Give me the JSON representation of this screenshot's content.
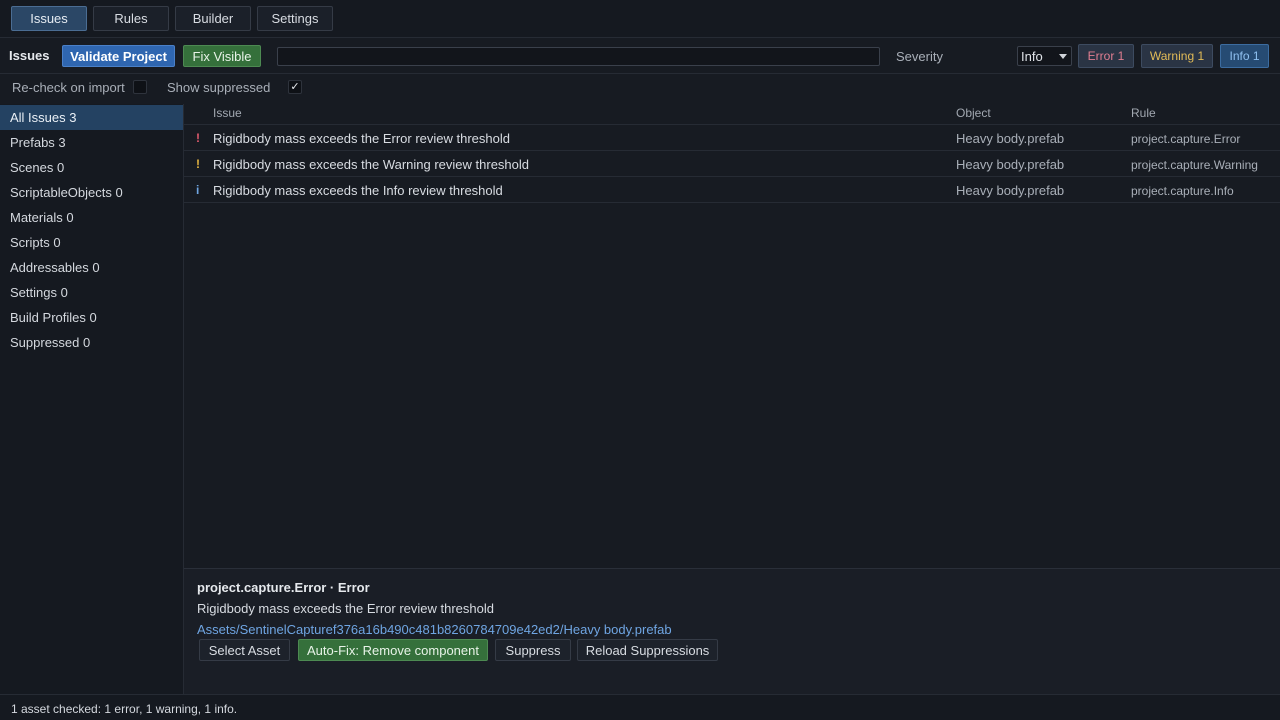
{
  "tabs": {
    "issues": "Issues",
    "rules": "Rules",
    "builder": "Builder",
    "settings": "Settings"
  },
  "toolbar": {
    "title": "Issues",
    "validate_label": "Validate Project",
    "fix_visible_label": "Fix Visible",
    "search_value": "",
    "severity_label": "Severity",
    "severity_selected": "Info",
    "pill_error": "Error 1",
    "pill_warning": "Warning 1",
    "pill_info": "Info 1"
  },
  "options": {
    "recheck_label": "Re-check on import",
    "recheck_checked": false,
    "show_suppressed_label": "Show suppressed",
    "show_suppressed_checked": true,
    "check_glyph": "✓"
  },
  "sidebar": {
    "items": [
      {
        "label": "All Issues 3"
      },
      {
        "label": "Prefabs 3"
      },
      {
        "label": "Scenes 0"
      },
      {
        "label": "ScriptableObjects 0"
      },
      {
        "label": "Materials 0"
      },
      {
        "label": "Scripts 0"
      },
      {
        "label": "Addressables 0"
      },
      {
        "label": "Settings 0"
      },
      {
        "label": "Build Profiles 0"
      },
      {
        "label": "Suppressed 0"
      }
    ]
  },
  "table": {
    "headers": {
      "issue": "Issue",
      "object": "Object",
      "rule": "Rule"
    },
    "rows": [
      {
        "sev": "!",
        "sev_color": "#e05a6e",
        "issue": "Rigidbody mass exceeds the Error review threshold",
        "object": "Heavy body.prefab",
        "rule": "project.capture.Error"
      },
      {
        "sev": "!",
        "sev_color": "#e3b341",
        "issue": "Rigidbody mass exceeds the Warning review threshold",
        "object": "Heavy body.prefab",
        "rule": "project.capture.Warning"
      },
      {
        "sev": "i",
        "sev_color": "#6fa5e2",
        "issue": "Rigidbody mass exceeds the Info review threshold",
        "object": "Heavy body.prefab",
        "rule": "project.capture.Info"
      }
    ]
  },
  "details": {
    "title": "project.capture.Error · Error",
    "message": "Rigidbody mass exceeds the Error review threshold",
    "path": "Assets/SentinelCapturef376a16b490c481b8260784709e42ed2/Heavy body.prefab",
    "select_asset": "Select Asset",
    "auto_fix": "Auto-Fix: Remove component",
    "suppress": "Suppress",
    "reload": "Reload Suppressions"
  },
  "status": {
    "text": "1 asset checked: 1 error, 1 warning, 1 info."
  }
}
